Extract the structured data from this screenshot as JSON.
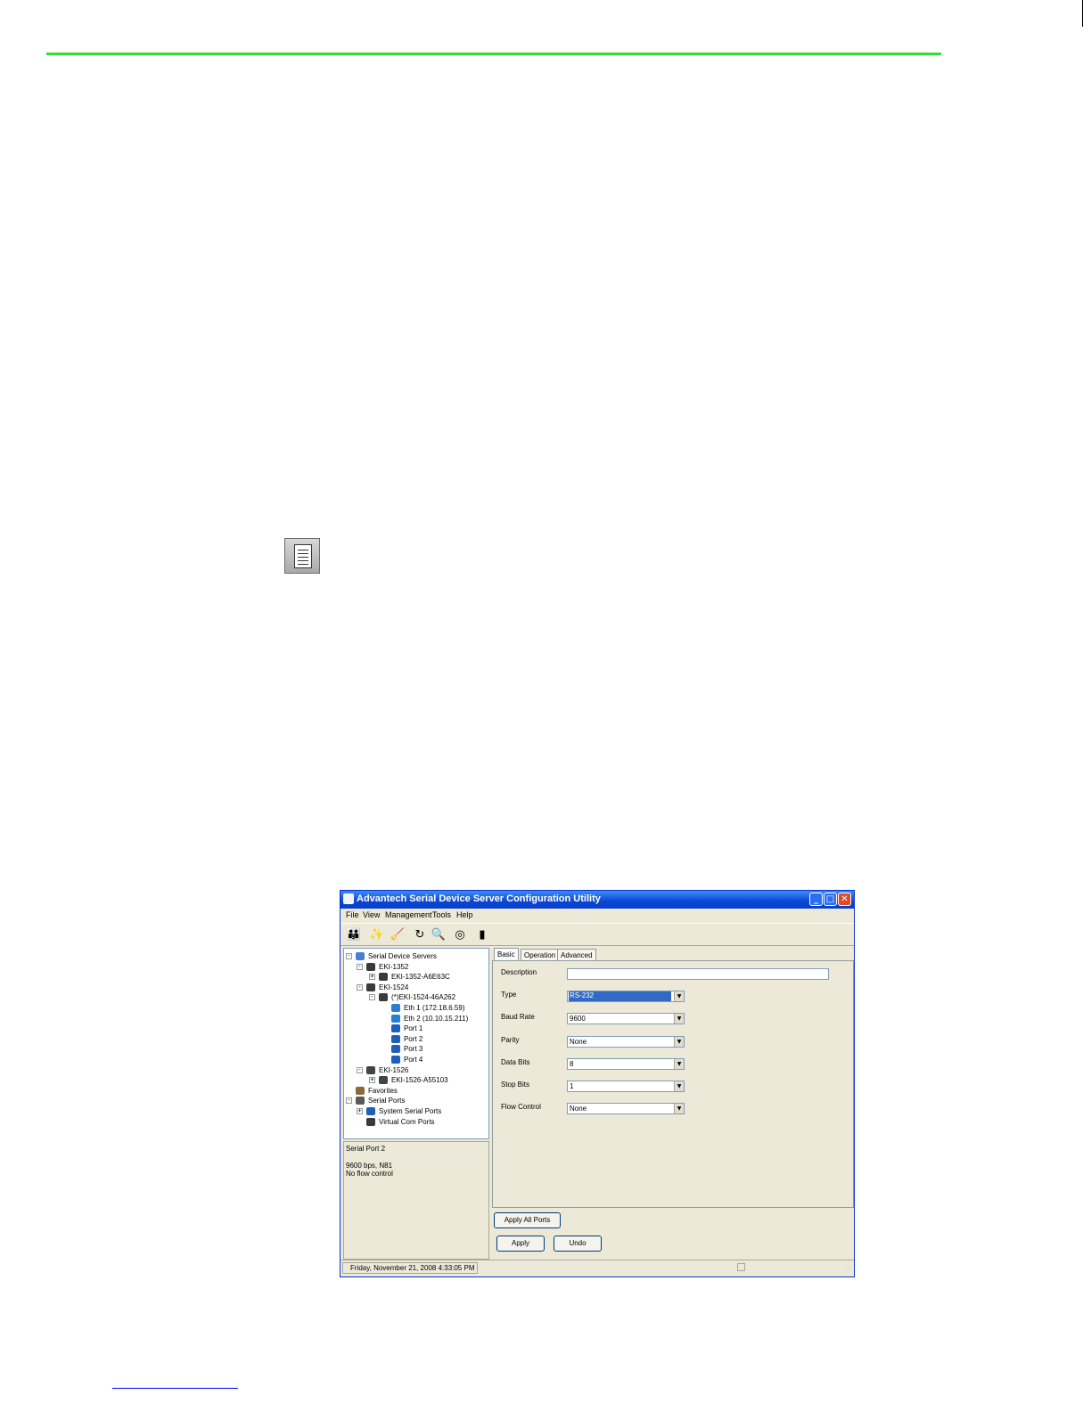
{
  "page": {
    "rule_color": "#33dd33"
  },
  "window": {
    "title": "Advantech Serial Device Server Configuration Utility",
    "title_color": "#0a46d4",
    "menu": [
      "File",
      "View",
      "Management",
      "Tools",
      "Help"
    ],
    "toolbar_icons": [
      "users-icon",
      "wand-icon",
      "broom-icon",
      "refresh-icon",
      "search-icon",
      "binoculars-icon",
      "device-icon"
    ],
    "tree": [
      {
        "label": "Serial Device Servers",
        "icon": "network-icon",
        "expander": "−"
      },
      {
        "label": "EKI-1352",
        "icon": "device-icon",
        "expander": "−"
      },
      {
        "label": "EKI-1352-A6E63C",
        "icon": "device-icon",
        "expander": "+"
      },
      {
        "label": "EKI-1524",
        "icon": "device-icon",
        "expander": "−"
      },
      {
        "label": "(*)EKI-1524-46A262",
        "icon": "device-icon",
        "expander": "−"
      },
      {
        "label": "Eth 1 (172.18.6.59)",
        "icon": "ethernet-icon",
        "expander": ""
      },
      {
        "label": "Eth 2 (10.10.15.211)",
        "icon": "ethernet-icon",
        "expander": ""
      },
      {
        "label": "Port 1",
        "icon": "port-icon",
        "expander": ""
      },
      {
        "label": "Port 2",
        "icon": "port-icon",
        "expander": ""
      },
      {
        "label": "Port 3",
        "icon": "port-icon",
        "expander": ""
      },
      {
        "label": "Port 4",
        "icon": "port-icon",
        "expander": ""
      },
      {
        "label": "EKI-1526",
        "icon": "rack-icon",
        "expander": "−"
      },
      {
        "label": "EKI-1526-A55103",
        "icon": "rack-icon",
        "expander": "+"
      },
      {
        "label": "Favorites",
        "icon": "favorites-icon",
        "expander": ""
      },
      {
        "label": "Serial Ports",
        "icon": "serial-icon",
        "expander": "−"
      },
      {
        "label": "System Serial Ports",
        "icon": "port-icon",
        "expander": "+"
      },
      {
        "label": "Virtual Com Ports",
        "icon": "device-icon",
        "expander": ""
      }
    ],
    "info": {
      "line1": "Serial Port 2",
      "line2": "9600 bps, N81",
      "line3": "No flow control"
    },
    "tabs": [
      "Basic",
      "Operation",
      "Advanced"
    ],
    "fields": {
      "description": {
        "label": "Description",
        "value": ""
      },
      "type": {
        "label": "Type",
        "value": "RS-232"
      },
      "baud_rate": {
        "label": "Baud Rate",
        "value": "9600"
      },
      "parity": {
        "label": "Parity",
        "value": "None"
      },
      "data_bits": {
        "label": "Data Bits",
        "value": "8"
      },
      "stop_bits": {
        "label": "Stop Bits",
        "value": "1"
      },
      "flow_control": {
        "label": "Flow Control",
        "value": "None"
      }
    },
    "buttons": {
      "apply_all": "Apply All Ports",
      "apply": "Apply",
      "undo": "Undo"
    },
    "status": "Friday, November 21, 2008  4:33:05 PM"
  }
}
